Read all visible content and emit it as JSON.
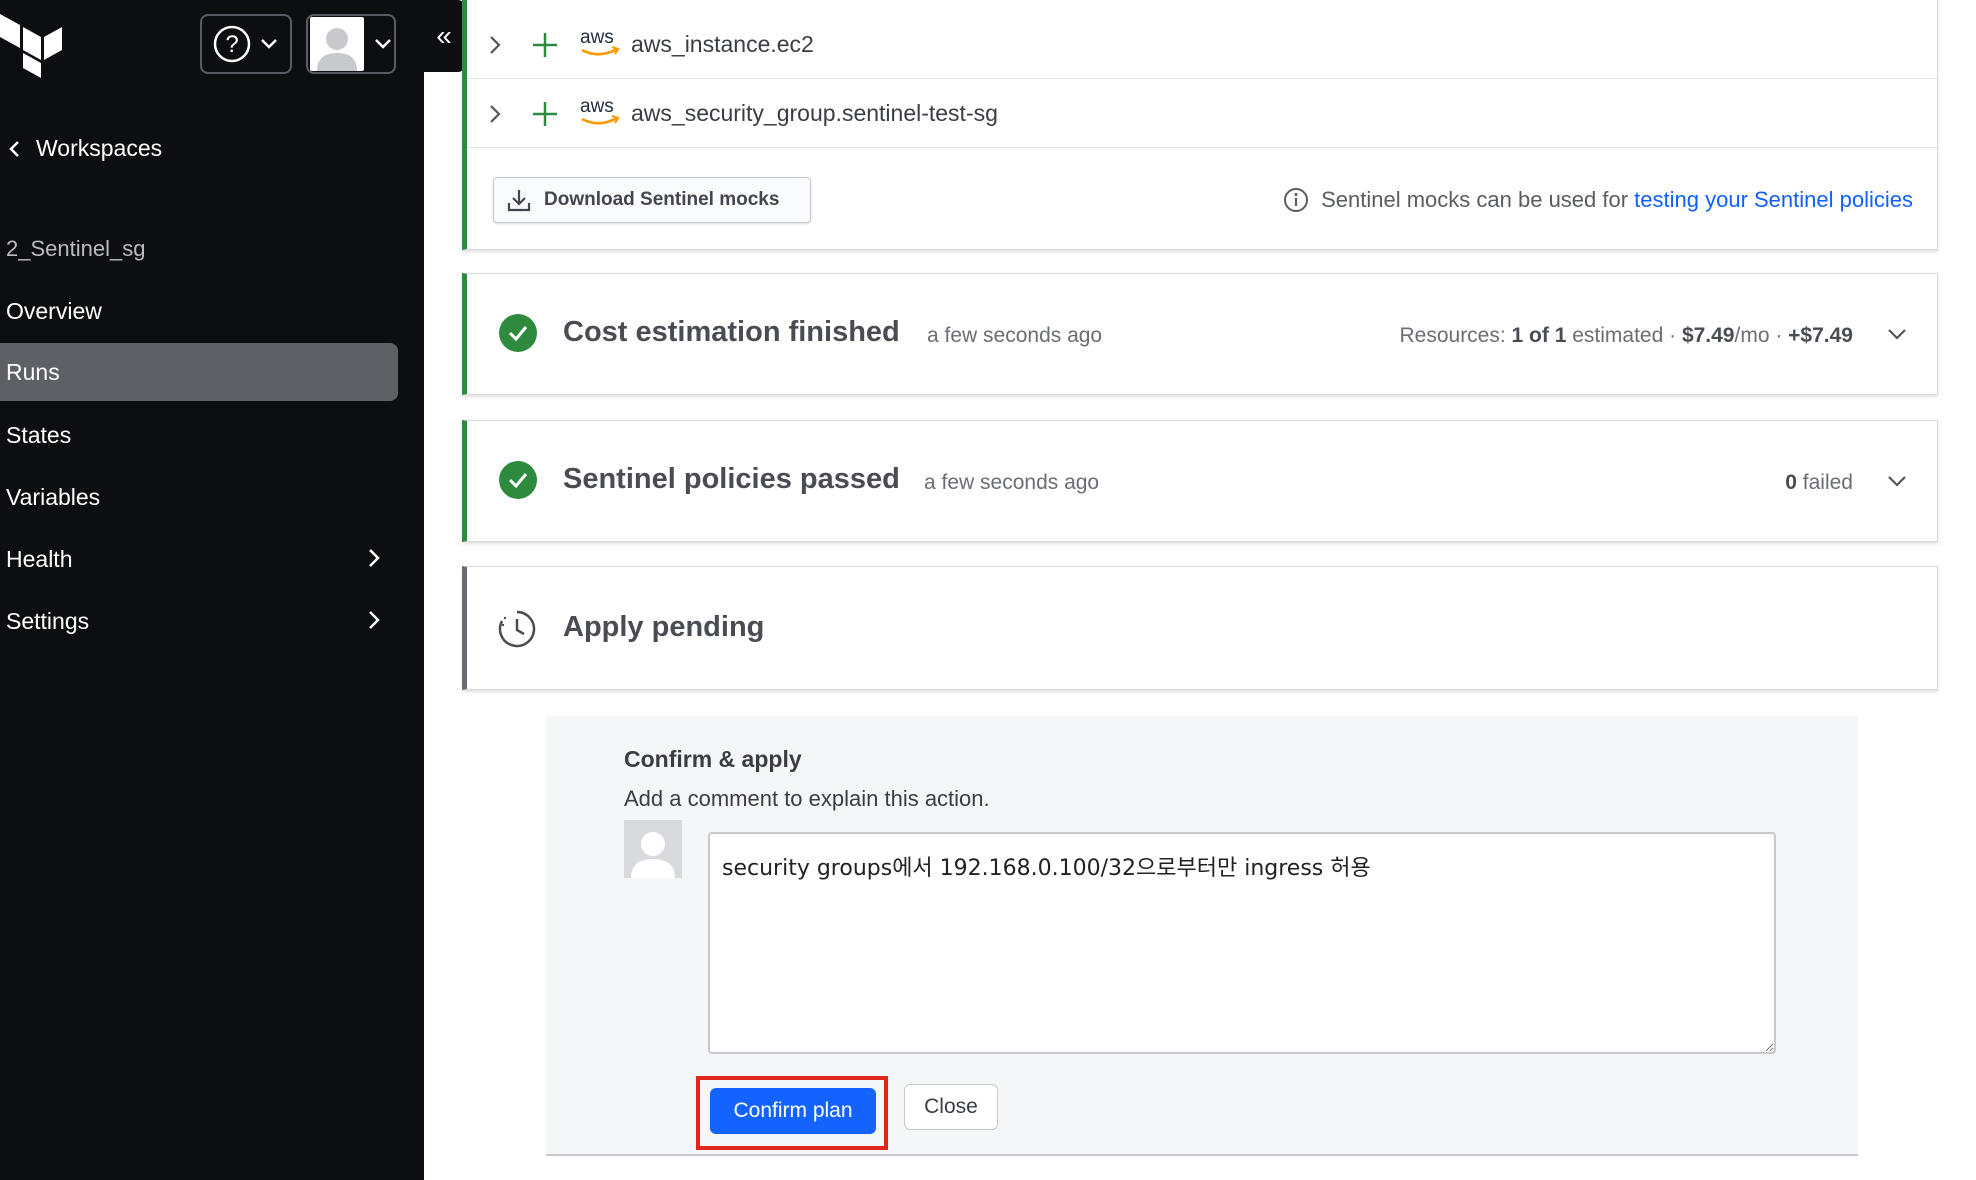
{
  "sidebar": {
    "workspaces_label": "Workspaces",
    "workspace_name": "2_Sentinel_sg",
    "items": [
      {
        "label": "Overview"
      },
      {
        "label": "Runs"
      },
      {
        "label": "States"
      },
      {
        "label": "Variables"
      },
      {
        "label": "Health"
      },
      {
        "label": "Settings"
      }
    ],
    "collapse_glyph": "«"
  },
  "resources": [
    {
      "provider": "aws",
      "name": "aws_instance.ec2"
    },
    {
      "provider": "aws",
      "name": "aws_security_group.sentinel-test-sg"
    }
  ],
  "mocks": {
    "download_label": "Download Sentinel mocks",
    "info_text": "Sentinel mocks can be used for ",
    "info_link": "testing your Sentinel policies"
  },
  "cost": {
    "title": "Cost estimation finished",
    "time": "a few seconds ago",
    "summary_prefix": "Resources: ",
    "summary_count": "1 of 1",
    "summary_mid": " estimated · ",
    "summary_monthly": "$7.49",
    "summary_unit": "/mo · ",
    "summary_delta": "+$7.49"
  },
  "sentinel": {
    "title": "Sentinel policies passed",
    "time": "a few seconds ago",
    "failed_count": "0",
    "failed_label": " failed"
  },
  "apply": {
    "title": "Apply pending"
  },
  "confirm": {
    "title": "Confirm & apply",
    "subtitle": "Add a comment to explain this action.",
    "comment_value": "security groups에서 192.168.0.100/32으로부터만 ingress 허용",
    "confirm_label": "Confirm plan",
    "close_label": "Close"
  },
  "colors": {
    "success": "#2e8b3e",
    "primary": "#1563ff",
    "highlight": "#e0251b"
  }
}
